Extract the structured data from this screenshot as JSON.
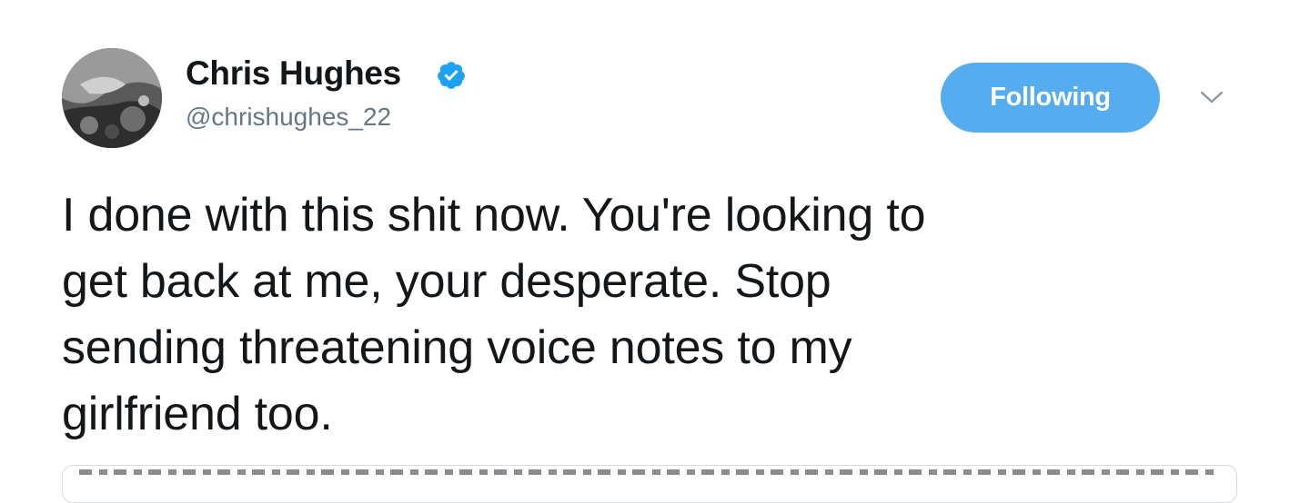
{
  "tweet": {
    "author": {
      "display_name": "Chris Hughes",
      "handle": "@chrishughes_22",
      "verified": true,
      "avatar_icon": "profile-photo"
    },
    "follow_button": {
      "label": "Following"
    },
    "menu_icon": "chevron-down-icon",
    "text_lines": [
      "I done with this shit now. You're looking to",
      "get back at me, your desperate. Stop",
      "sending threatening voice notes to my",
      "girlfriend too."
    ]
  },
  "colors": {
    "accent": "#55acee",
    "verified": "#1da1f2",
    "text": "#14171a",
    "secondary_text": "#657786"
  }
}
